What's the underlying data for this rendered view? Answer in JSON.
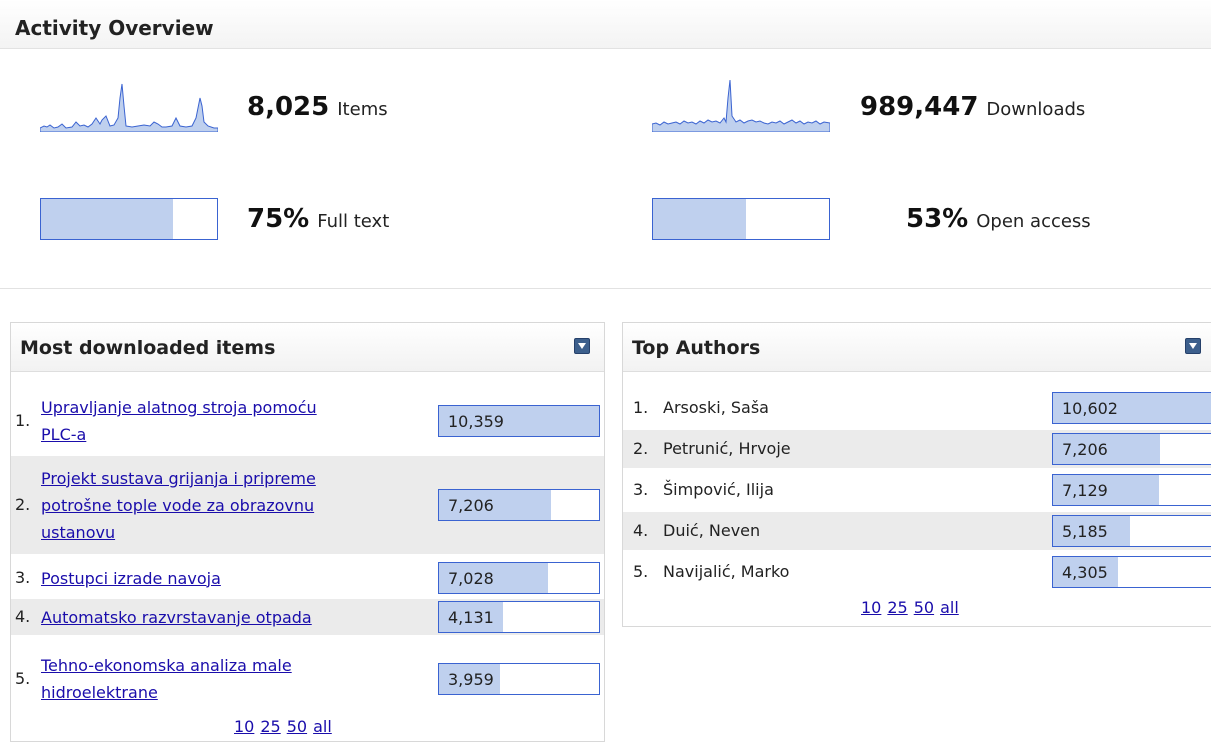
{
  "overview": {
    "title": "Activity Overview",
    "items": {
      "value": "8,025",
      "label": "Items"
    },
    "downloads": {
      "value": "989,447",
      "label": "Downloads"
    },
    "fulltext": {
      "value": "75%",
      "label": "Full text",
      "fraction": 0.75
    },
    "openaccess": {
      "value": "53%",
      "label": "Open access",
      "fraction": 0.53
    }
  },
  "most_downloaded": {
    "title": "Most downloaded items",
    "rows": [
      {
        "rank": "1.",
        "title_lines": [
          "Upravljanje alatnog stroja pomoću",
          "PLC-a"
        ],
        "count": "10,359",
        "fraction": 1.0
      },
      {
        "rank": "2.",
        "title_lines": [
          "Projekt sustava grijanja i pripreme",
          "potrošne tople vode za obrazovnu",
          "ustanovu"
        ],
        "count": "7,206",
        "fraction": 0.7
      },
      {
        "rank": "3.",
        "title_lines": [
          "Postupci izrade navoja"
        ],
        "count": "7,028",
        "fraction": 0.68
      },
      {
        "rank": "4.",
        "title_lines": [
          "Automatsko razvrstavanje otpada"
        ],
        "count": "4,131",
        "fraction": 0.4
      },
      {
        "rank": "5.",
        "title_lines": [
          "Tehno-ekonomska analiza male",
          "hidroelektrane"
        ],
        "count": "3,959",
        "fraction": 0.38
      }
    ],
    "pager": [
      "10",
      "25",
      "50",
      "all"
    ]
  },
  "top_authors": {
    "title": "Top Authors",
    "rows": [
      {
        "rank": "1.",
        "name": "Arsoski, Saša",
        "count": "10,602",
        "fraction": 1.0
      },
      {
        "rank": "2.",
        "name": "Petrunić, Hrvoje",
        "count": "7,206",
        "fraction": 0.68
      },
      {
        "rank": "3.",
        "name": "Šimpović, Ilija",
        "count": "7,129",
        "fraction": 0.67
      },
      {
        "rank": "4.",
        "name": "Duić, Neven",
        "count": "5,185",
        "fraction": 0.49
      },
      {
        "rank": "5.",
        "name": "Navijalić, Marko",
        "count": "4,305",
        "fraction": 0.41
      }
    ],
    "pager": [
      "10",
      "25",
      "50",
      "all"
    ]
  },
  "colors": {
    "bar_fill": "#bfd0ee",
    "bar_border": "#3a63d1",
    "link": "#1a0dab",
    "alt_row": "#ebebeb"
  }
}
